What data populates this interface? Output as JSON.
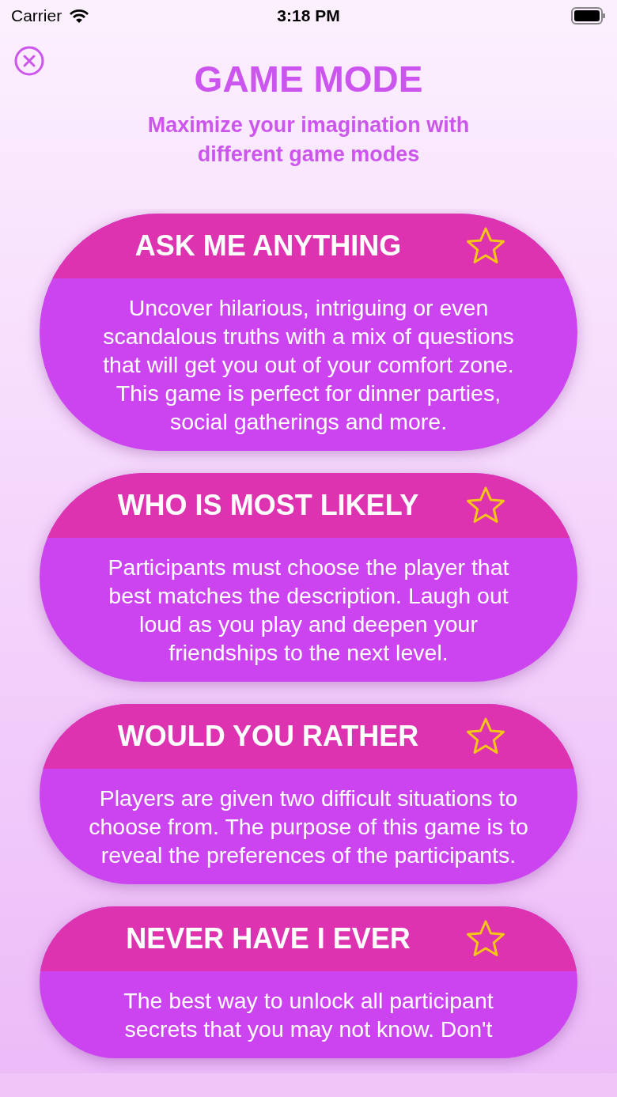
{
  "status_bar": {
    "carrier": "Carrier",
    "time": "3:18 PM"
  },
  "title": "GAME MODE",
  "subtitle": "Maximize your imagination with different game modes",
  "game_modes": [
    {
      "title": "ASK ME ANYTHING",
      "description": "Uncover hilarious, intriguing or even scandalous truths with a mix of questions that will get you out of your comfort zone. This game is perfect for dinner parties, social gatherings and more.",
      "favorite": false
    },
    {
      "title": "WHO IS MOST LIKELY",
      "description": "Participants must choose the player that best matches the description. Laugh out loud as you play and deepen your friendships to the next level.",
      "favorite": false
    },
    {
      "title": "WOULD YOU RATHER",
      "description": "Players are given two difficult situations to choose from. The purpose of this game is to reveal the preferences of the participants.",
      "favorite": false
    },
    {
      "title": "NEVER HAVE I EVER",
      "description": "The best way to unlock all participant secrets that you may not know. Don't",
      "favorite": false
    }
  ]
}
